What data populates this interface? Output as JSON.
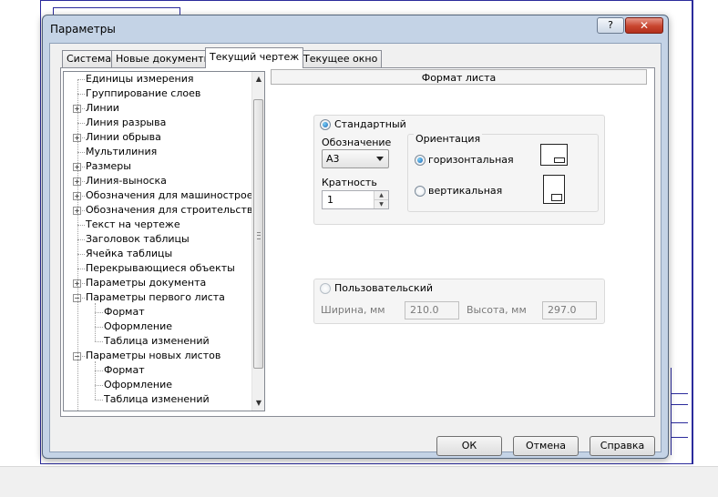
{
  "dialog": {
    "title": "Параметры",
    "help_glyph": "?",
    "close_glyph": "✕"
  },
  "tabs": [
    {
      "label": "Система"
    },
    {
      "label": "Новые документы"
    },
    {
      "label": "Текущий чертеж"
    },
    {
      "label": "Текущее окно"
    }
  ],
  "active_tab": "Текущий чертеж",
  "tree": {
    "items": [
      {
        "label": "Единицы измерения",
        "level": 0,
        "expander": "none"
      },
      {
        "label": "Группирование слоев",
        "level": 0,
        "expander": "none"
      },
      {
        "label": "Линии",
        "level": 0,
        "expander": "plus"
      },
      {
        "label": "Линия разрыва",
        "level": 0,
        "expander": "none"
      },
      {
        "label": "Линии обрыва",
        "level": 0,
        "expander": "plus"
      },
      {
        "label": "Мультилиния",
        "level": 0,
        "expander": "none"
      },
      {
        "label": "Размеры",
        "level": 0,
        "expander": "plus"
      },
      {
        "label": "Линия-выноска",
        "level": 0,
        "expander": "plus"
      },
      {
        "label": "Обозначения для машиностроения",
        "level": 0,
        "expander": "plus"
      },
      {
        "label": "Обозначения для строительства",
        "level": 0,
        "expander": "plus"
      },
      {
        "label": "Текст на чертеже",
        "level": 0,
        "expander": "none"
      },
      {
        "label": "Заголовок таблицы",
        "level": 0,
        "expander": "none"
      },
      {
        "label": "Ячейка таблицы",
        "level": 0,
        "expander": "none"
      },
      {
        "label": "Перекрывающиеся объекты",
        "level": 0,
        "expander": "none"
      },
      {
        "label": "Параметры документа",
        "level": 0,
        "expander": "plus"
      },
      {
        "label": "Параметры первого листа",
        "level": 0,
        "expander": "minus"
      },
      {
        "label": "Формат",
        "level": 1,
        "expander": "none"
      },
      {
        "label": "Оформление",
        "level": 1,
        "expander": "none"
      },
      {
        "label": "Таблица изменений",
        "level": 1,
        "expander": "none"
      },
      {
        "label": "Параметры новых листов",
        "level": 0,
        "expander": "minus"
      },
      {
        "label": "Формат",
        "level": 1,
        "expander": "none"
      },
      {
        "label": "Оформление",
        "level": 1,
        "expander": "none"
      },
      {
        "label": "Таблица изменений",
        "level": 1,
        "expander": "none"
      }
    ]
  },
  "panel": {
    "header": "Формат листа",
    "standard": {
      "label": "Стандартный",
      "checked": true,
      "designation_label": "Обозначение",
      "designation_value": "А3",
      "multiplicity_label": "Кратность",
      "multiplicity_value": "1",
      "orientation": {
        "label": "Ориентация",
        "horizontal": "горизонтальная",
        "vertical": "вертикальная",
        "selected": "горизонтальная"
      }
    },
    "custom": {
      "label": "Пользовательский",
      "checked": false,
      "width_label": "Ширина, мм",
      "width_value": "210.0",
      "height_label": "Высота, мм",
      "height_value": "297.0"
    }
  },
  "buttons": {
    "ok": "ОК",
    "cancel": "Отмена",
    "help": "Справка"
  },
  "colors": {
    "dialog_frame": "#c4d3e6",
    "close_button": "#c8452f",
    "radio_selected": "#1b63b6",
    "drawing_lines": "#2b2b9c"
  }
}
